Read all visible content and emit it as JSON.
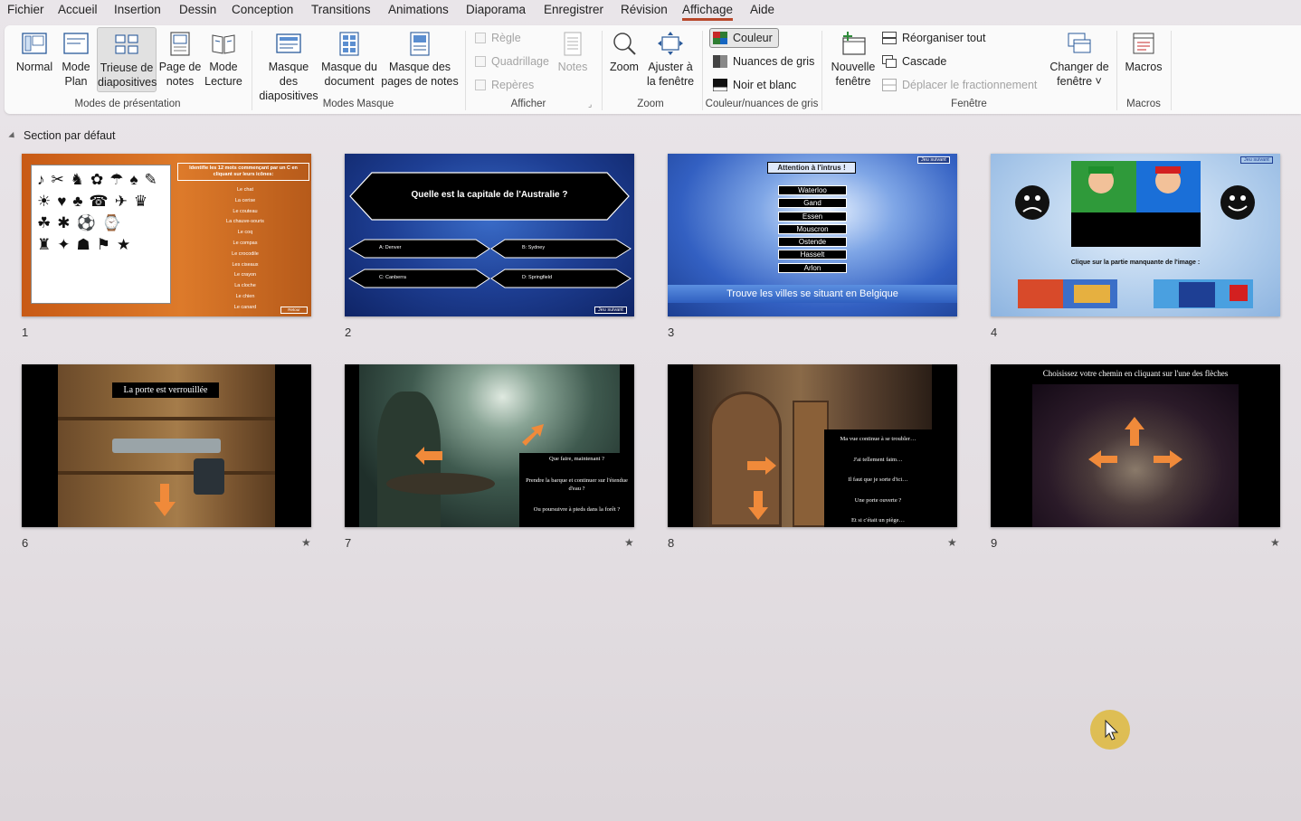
{
  "menu": {
    "items": [
      "Fichier",
      "Accueil",
      "Insertion",
      "Dessin",
      "Conception",
      "Transitions",
      "Animations",
      "Diaporama",
      "Enregistrer",
      "Révision",
      "Affichage",
      "Aide"
    ],
    "active": "Affichage"
  },
  "ribbon": {
    "groups": {
      "presentation": "Modes de présentation",
      "masque": "Modes Masque",
      "afficher": "Afficher",
      "zoom": "Zoom",
      "couleur": "Couleur/nuances de gris",
      "fenetre": "Fenêtre",
      "macros": "Macros"
    },
    "buttons": {
      "normal": "Normal",
      "mode_plan": [
        "Mode",
        "Plan"
      ],
      "trieuse": [
        "Trieuse de",
        "diapositives"
      ],
      "page_notes": [
        "Page de",
        "notes"
      ],
      "mode_lecture": [
        "Mode",
        "Lecture"
      ],
      "masque_diapos": [
        "Masque des",
        "diapositives"
      ],
      "masque_document": [
        "Masque du",
        "document"
      ],
      "masque_pages_notes": [
        "Masque des",
        "pages de notes"
      ],
      "regle": "Règle",
      "quadrillage": "Quadrillage",
      "reperes": "Repères",
      "notes": "Notes",
      "zoom": "Zoom",
      "ajuster": [
        "Ajuster à",
        "la fenêtre"
      ],
      "couleur": "Couleur",
      "nuances": "Nuances de gris",
      "noir_blanc": "Noir et blanc",
      "nouvelle_fenetre": [
        "Nouvelle",
        "fenêtre"
      ],
      "reorganiser": "Réorganiser tout",
      "cascade": "Cascade",
      "deplacer": "Déplacer le fractionnement",
      "changer_fenetre": [
        "Changer de",
        "fenêtre ˅"
      ],
      "macros": "Macros"
    }
  },
  "section": {
    "title": "Section par défaut"
  },
  "slides": {
    "s1": {
      "number": "1",
      "title": "Identifie les 12 mots commençant par un C en cliquant sur leurs icônes:",
      "words": [
        "Le chat",
        "La cerise",
        "Le couteau",
        "La chauve-souris",
        "Le coq",
        "Le compas",
        "Le crocodile",
        "Les ciseaux",
        "Le crayon",
        "La cloche",
        "Le chien",
        "Le canard"
      ],
      "button": "Retour"
    },
    "s2": {
      "number": "2",
      "question": "Quelle est la capitale de l'Australie ?",
      "answers": [
        "A: Denver",
        "B: Sydney",
        "C: Canberra",
        "D: Springfield"
      ],
      "button": "Jeu suivant"
    },
    "s3": {
      "number": "3",
      "title": "Attention à l'intrus !",
      "cities": [
        "Waterloo",
        "Gand",
        "Essen",
        "Mouscron",
        "Ostende",
        "Hasselt",
        "Arlon"
      ],
      "footer": "Trouve les villes se situant en Belgique",
      "button": "Jeu suivant"
    },
    "s4": {
      "number": "4",
      "caption": "Clique sur la partie manquante de l'image :",
      "button": "Jeu suivant"
    },
    "s6": {
      "number": "6",
      "caption": "La porte est verrouillée",
      "star": "★"
    },
    "s7": {
      "number": "7",
      "lines": [
        "Que faire, maintenant ?",
        "Prendre la barque et continuer sur l'étendue d'eau ?",
        "Ou poursuivre à pieds dans la forêt ?"
      ],
      "star": "★"
    },
    "s8": {
      "number": "8",
      "lines": [
        "Ma vue continue à se troubler…",
        "J'ai tellement faim…",
        "Il faut que je sorte d'ici…",
        "Une porte ouverte ?",
        "Et si c'était un piège…"
      ],
      "star": "★"
    },
    "s9": {
      "number": "9",
      "caption": "Choisissez votre chemin en cliquant sur l'une des flèches",
      "star": "★"
    }
  },
  "colors": {
    "accent": "#b7472a",
    "arrow": "#f08a3a"
  },
  "icons": [
    "normal-view-icon",
    "outline-view-icon",
    "slide-sorter-icon",
    "notes-page-icon",
    "reading-view-icon",
    "slide-master-icon",
    "handout-master-icon",
    "notes-master-icon",
    "notes-icon",
    "zoom-icon",
    "fit-window-icon",
    "color-icon",
    "grayscale-icon",
    "black-white-icon",
    "new-window-icon",
    "arrange-all-icon",
    "cascade-icon",
    "move-split-icon",
    "switch-windows-icon",
    "macros-icon"
  ]
}
